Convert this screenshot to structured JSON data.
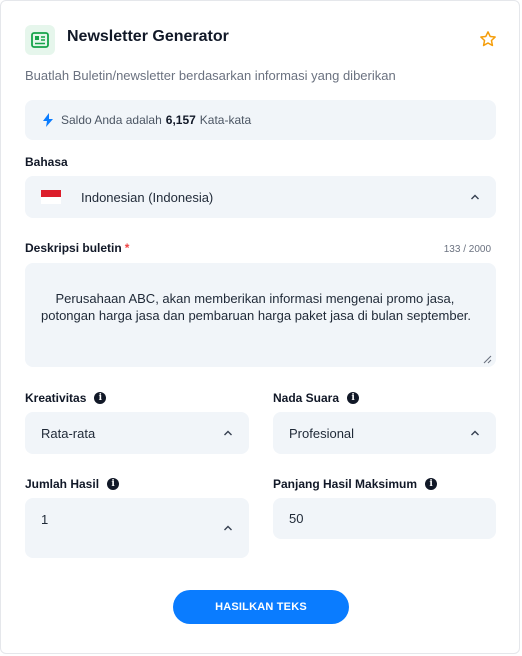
{
  "header": {
    "title": "Newsletter Generator",
    "subtitle": "Buatlah Buletin/newsletter berdasarkan informasi yang diberikan"
  },
  "balance": {
    "prefix": "Saldo Anda adalah",
    "amount": "6,157",
    "suffix": "Kata-kata"
  },
  "language": {
    "label": "Bahasa",
    "value": "Indonesian (Indonesia)"
  },
  "description": {
    "label": "Deskripsi buletin",
    "required_mark": "*",
    "counter": "133 / 2000",
    "value": "Perusahaan ABC, akan memberikan informasi mengenai promo jasa, potongan harga jasa dan pembaruan harga paket jasa di bulan september."
  },
  "creativity": {
    "label": "Kreativitas",
    "value": "Rata-rata"
  },
  "tone": {
    "label": "Nada Suara",
    "value": "Profesional"
  },
  "result_count": {
    "label": "Jumlah Hasil",
    "value": "1"
  },
  "max_length": {
    "label": "Panjang Hasil Maksimum",
    "value": "50"
  },
  "actions": {
    "generate_label": "HASILKAN TEKS"
  },
  "colors": {
    "accent": "#0a7cff",
    "icon_green": "#16a34a",
    "star": "#f59e0b",
    "field_bg": "#f1f5f9"
  },
  "icons": {
    "title": "newsletter-icon",
    "favorite": "star-icon",
    "balance": "bolt-icon",
    "info": "info-icon",
    "dropdown": "chevron-up-icon",
    "flag": "indonesia-flag-icon"
  }
}
